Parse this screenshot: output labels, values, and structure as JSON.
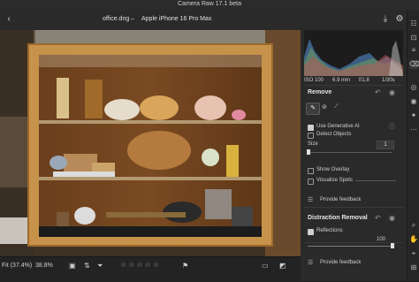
{
  "window": {
    "title": "Camera Raw 17.1 beta"
  },
  "tabbar": {
    "filename": "office.dng",
    "camera": "Apple iPhone 16 Pro Max"
  },
  "histogram": {
    "info": {
      "iso": "ISO 100",
      "focal": "6.9 mm",
      "aperture": "f/1.8",
      "shutter": "1/30s"
    }
  },
  "remove": {
    "title": "Remove",
    "use_generative_ai": "Use Generative AI",
    "detect_objects": "Detect Objects",
    "size_label": "Size",
    "size_value": "1",
    "show_overlay": "Show Overlay",
    "visualize_spots": "Visualize Spots",
    "feedback": "Provide feedback"
  },
  "distraction": {
    "title": "Distraction Removal",
    "reflections": "Reflections",
    "reflections_value": "100",
    "feedback": "Provide feedback"
  },
  "bottombar": {
    "fit": "Fit (37.4%)",
    "zoom": "38.8%"
  },
  "colors": {
    "panel": "#2a2a2a",
    "accent": "#3b8cff",
    "background": "#1e1e1e"
  }
}
